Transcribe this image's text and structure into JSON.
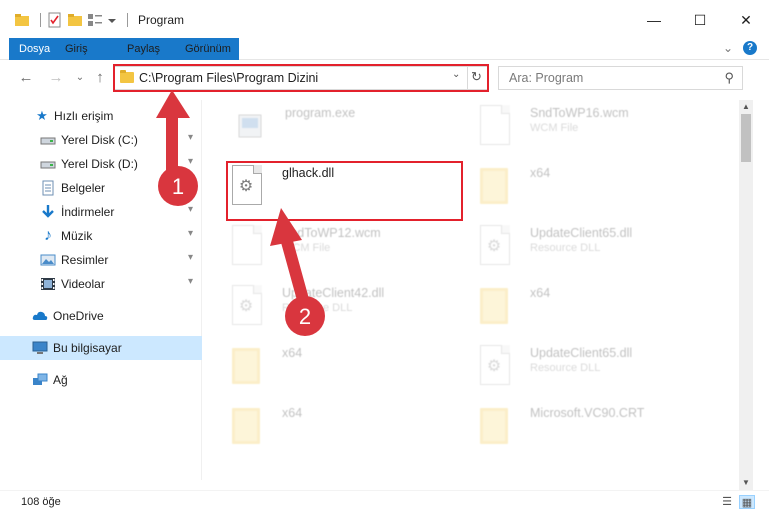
{
  "window": {
    "title": "Program",
    "minimize": "—",
    "maximize": "☐",
    "close": "✕"
  },
  "ribbon": {
    "tabs": [
      "Dosya",
      "Giriş",
      "Paylaş",
      "Görünüm"
    ],
    "expand": "⌄",
    "help": "?"
  },
  "nav": {
    "back": "←",
    "forward": "→",
    "recent": "⌄",
    "up": "↑",
    "address_path": "C:\\Program Files\\Program Dizini",
    "address_dropdown": "⌄",
    "refresh": "↻",
    "search_placeholder": "Ara: Program",
    "search_icon": "⚲"
  },
  "sidebar": {
    "items": [
      {
        "label": "Hızlı erişim",
        "icon": "star-icon",
        "glyph": "★",
        "color": "#1979ca",
        "pinned": false
      },
      {
        "label": "Yerel Disk (C:)",
        "icon": "drive-icon",
        "glyph": "▭",
        "color": "#555555",
        "pinned": true
      },
      {
        "label": "Yerel Disk (D:)",
        "icon": "drive-icon",
        "glyph": "▭",
        "color": "#555555",
        "pinned": true
      },
      {
        "label": "Belgeler",
        "icon": "documents-icon",
        "glyph": "▤",
        "color": "#6d8fb3",
        "pinned": true
      },
      {
        "label": "İndirmeler",
        "icon": "download-icon",
        "glyph": "↓",
        "color": "#1979ca",
        "pinned": true
      },
      {
        "label": "Müzik",
        "icon": "music-icon",
        "glyph": "♪",
        "color": "#1979ca",
        "pinned": true
      },
      {
        "label": "Resimler",
        "icon": "pictures-icon",
        "glyph": "▣",
        "color": "#4a8cc9",
        "pinned": true
      },
      {
        "label": "Videolar",
        "icon": "video-icon",
        "glyph": "▦",
        "color": "#555555",
        "pinned": true
      },
      {
        "label": "OneDrive",
        "icon": "cloud-icon",
        "glyph": "☁",
        "color": "#1979ca",
        "pinned": false
      },
      {
        "label": "Bu bilgisayar",
        "icon": "computer-icon",
        "glyph": "▬",
        "color": "#3a84c9",
        "pinned": false
      },
      {
        "label": "Ağ",
        "icon": "network-icon",
        "glyph": "⊞",
        "color": "#3a84c9",
        "pinned": false
      }
    ],
    "pin_glyph": "📌"
  },
  "files": [
    {
      "name": "program.exe",
      "sub": "",
      "kind": "exe"
    },
    {
      "name": "SndToWP16.wcm",
      "sub": "WCM File",
      "kind": "doc"
    },
    {
      "name": "glhack.dll",
      "sub": "",
      "kind": "dll"
    },
    {
      "name": "x64",
      "sub": "",
      "kind": "folder"
    },
    {
      "name": "SndToWP12.wcm",
      "sub": "WCM File",
      "kind": "doc"
    },
    {
      "name": "UpdateClient65.dll",
      "sub": "Resource DLL",
      "kind": "dll"
    },
    {
      "name": "UpdateClient42.dll",
      "sub": "Resource DLL",
      "kind": "dll"
    },
    {
      "name": "x64",
      "sub": "",
      "kind": "folder"
    },
    {
      "name": "x64",
      "sub": "",
      "kind": "folder"
    },
    {
      "name": "UpdateClient65.dll",
      "sub": "Resource DLL",
      "kind": "dll"
    },
    {
      "name": "x64",
      "sub": "",
      "kind": "folder"
    },
    {
      "name": "Microsoft.VC90.CRT",
      "sub": "",
      "kind": "folder"
    }
  ],
  "annotations": [
    "1",
    "2"
  ],
  "status": {
    "count": "108 öğe"
  },
  "colors": {
    "accent": "#1979ca",
    "highlight": "#e3212c",
    "badge": "#d9363e"
  }
}
